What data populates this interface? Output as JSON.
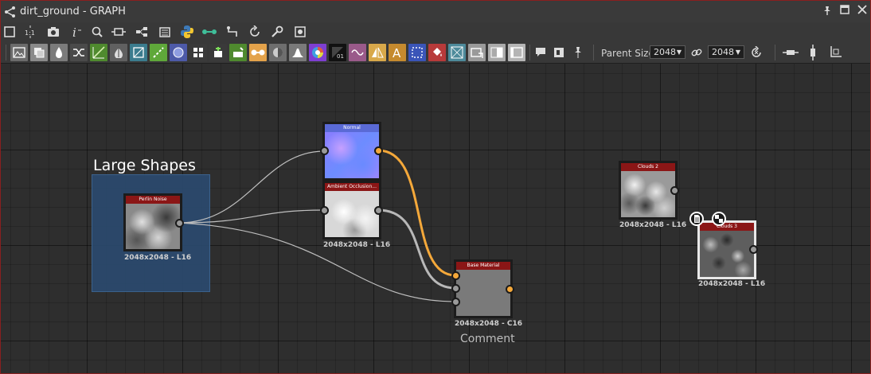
{
  "window": {
    "title": "dirt_ground - GRAPH",
    "icons": [
      "graph-icon",
      "pin-icon",
      "maximize-icon",
      "close-icon"
    ]
  },
  "toolbar_top": {
    "icons": [
      "fit-view-icon",
      "zoom-1-1-icon",
      "screenshot-icon",
      "info-icon",
      "search-icon",
      "frame-icon",
      "hierarchy-icon",
      "library-icon",
      "python-icon",
      "link-icon",
      "dot-icon",
      "refresh-icon",
      "tools-icon",
      "camera-icon"
    ]
  },
  "toolbar_nodes": {
    "icons": [
      "bitmap-icon",
      "grayscale-icon",
      "levels-icon",
      "shuffle-icon",
      "curve-icon",
      "blend-icon",
      "transform-icon",
      "gradient-icon",
      "circle-icon",
      "tile-icon",
      "fxmap-icon",
      "tint-icon",
      "pixel-icon",
      "sphere-icon",
      "histogram-icon",
      "color-wheel-icon",
      "uniform-icon",
      "warp-icon",
      "edge-icon",
      "text-icon",
      "selection-icon",
      "fill-icon",
      "normal-icon",
      "shape-icon",
      "gradient-map-icon",
      "input-icon"
    ],
    "extra_icons": [
      "comment-icon",
      "frame-node-icon",
      "pin-node-icon"
    ],
    "parent_size_label": "Parent Size:",
    "parent_size_value": "2048",
    "link_icon": "link-icon",
    "output_size_value": "2048",
    "reset_icon": "reset-icon",
    "align_icons": [
      "align-horizontal-icon",
      "align-vertical-icon",
      "snap-icon"
    ]
  },
  "graph": {
    "frame_title": "Large Shapes",
    "comment": "Comment",
    "nodes": [
      {
        "id": "perlin",
        "title": "Perlin Noise",
        "label": "2048x2048 - L16"
      },
      {
        "id": "normal",
        "title": "Normal",
        "label": ""
      },
      {
        "id": "ao",
        "title": "Ambient Occlusion...",
        "label": "2048x2048 - L16"
      },
      {
        "id": "base",
        "title": "Base Material",
        "label": "2048x2048 - C16"
      },
      {
        "id": "clouds2",
        "title": "Clouds 2",
        "label": "2048x2048 - L16"
      },
      {
        "id": "clouds3",
        "title": "Clouds 3",
        "label": "2048x2048 - L16"
      }
    ],
    "colors": {
      "wire_orange": "#f4a83a",
      "wire_gray": "#c8c8c8",
      "node_header": "#8b1616",
      "frame_fill": "#2b4a6e"
    }
  }
}
